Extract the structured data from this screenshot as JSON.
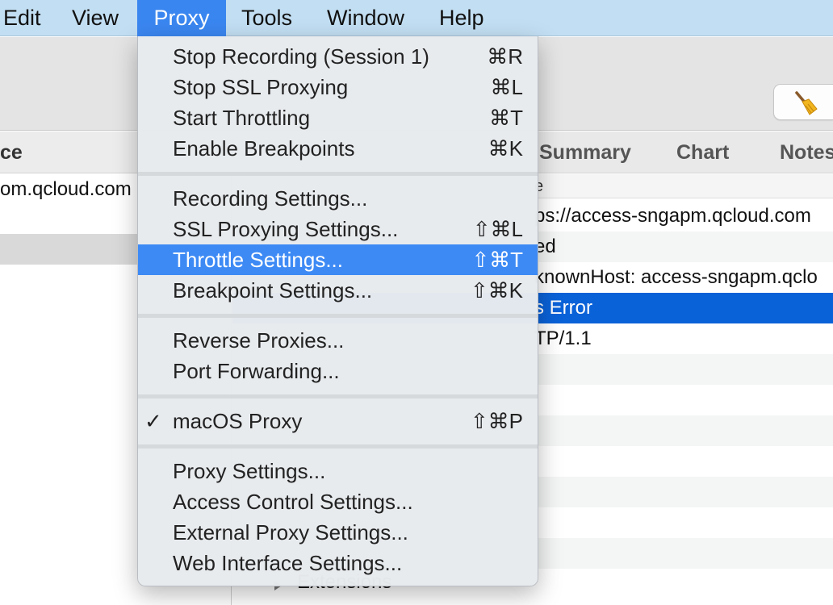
{
  "menubar": {
    "items": [
      {
        "label": "Edit"
      },
      {
        "label": "View"
      },
      {
        "label": "Proxy"
      },
      {
        "label": "Tools"
      },
      {
        "label": "Window"
      },
      {
        "label": "Help"
      }
    ]
  },
  "toolbar": {
    "broom_icon": "broom-icon"
  },
  "left": {
    "header": "ce",
    "row1": "om.qcloud.com",
    "extensions": "Extensions"
  },
  "right": {
    "tabs": [
      "Summary",
      "Chart",
      "Notes"
    ],
    "column_header": "e",
    "rows": [
      "ps://access-sngapm.qcloud.com",
      "ed",
      "knownHost: access-sngapm.qclo",
      "s Error",
      "TP/1.1"
    ]
  },
  "menu": {
    "check_glyph": "✓",
    "items": [
      {
        "label": "Stop Recording (Session 1)",
        "shortcut": "⌘R"
      },
      {
        "label": "Stop SSL Proxying",
        "shortcut": "⌘L"
      },
      {
        "label": "Start Throttling",
        "shortcut": "⌘T"
      },
      {
        "label": "Enable Breakpoints",
        "shortcut": "⌘K"
      },
      {
        "label": "Recording Settings..."
      },
      {
        "label": "SSL Proxying Settings...",
        "shortcut": "⇧⌘L"
      },
      {
        "label": "Throttle Settings...",
        "shortcut": "⇧⌘T",
        "highlighted": true
      },
      {
        "label": "Breakpoint Settings...",
        "shortcut": "⇧⌘K"
      },
      {
        "label": "Reverse Proxies..."
      },
      {
        "label": "Port Forwarding..."
      },
      {
        "label": "macOS Proxy",
        "shortcut": "⇧⌘P",
        "checked": true
      },
      {
        "label": "Proxy Settings..."
      },
      {
        "label": "Access Control Settings..."
      },
      {
        "label": "External Proxy Settings..."
      },
      {
        "label": "Web Interface Settings..."
      }
    ]
  }
}
